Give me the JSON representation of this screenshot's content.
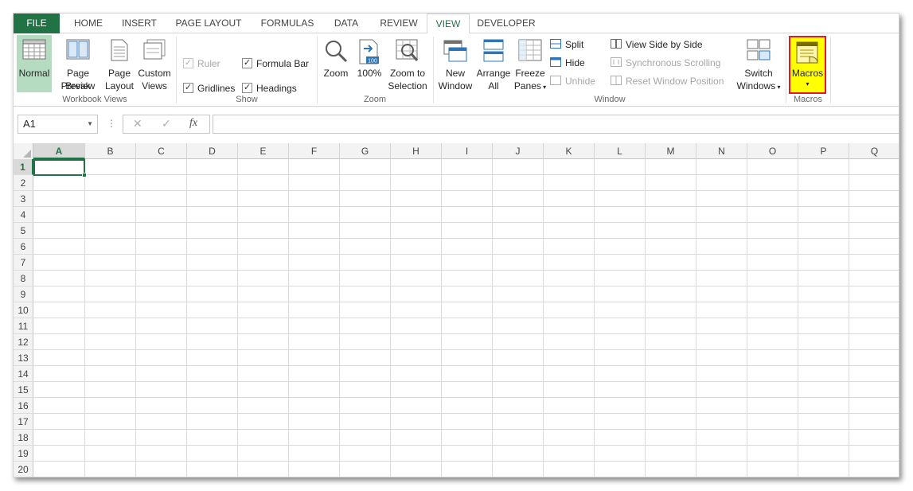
{
  "tabs": [
    "FILE",
    "HOME",
    "INSERT",
    "PAGE LAYOUT",
    "FORMULAS",
    "DATA",
    "REVIEW",
    "VIEW",
    "DEVELOPER"
  ],
  "active_tab": "VIEW",
  "colors": {
    "file_tab": "#217346",
    "accent": "#217346",
    "selected_button": "#b5dcc0",
    "highlight_fill": "#ffff00",
    "highlight_border": "#e8191d"
  },
  "ribbon": {
    "workbook_views": {
      "label": "Workbook Views",
      "normal": [
        "Normal"
      ],
      "page_break": [
        "Page Break",
        "Preview"
      ],
      "page_layout": [
        "Page",
        "Layout"
      ],
      "custom_views": [
        "Custom",
        "Views"
      ]
    },
    "show": {
      "label": "Show",
      "ruler": "Ruler",
      "formula_bar": "Formula Bar",
      "gridlines": "Gridlines",
      "headings": "Headings"
    },
    "zoom": {
      "label": "Zoom",
      "zoom": [
        "Zoom"
      ],
      "hundred": [
        "100%"
      ],
      "zoom_selection": [
        "Zoom to",
        "Selection"
      ],
      "icon_badge": "100"
    },
    "window": {
      "label": "Window",
      "new_window": [
        "New",
        "Window"
      ],
      "arrange_all": [
        "Arrange",
        "All"
      ],
      "freeze_panes": [
        "Freeze",
        "Panes"
      ],
      "split": "Split",
      "hide": "Hide",
      "unhide": "Unhide",
      "side_by_side": "View Side by Side",
      "sync_scroll": "Synchronous Scrolling",
      "reset_pos": "Reset Window Position",
      "switch_windows": [
        "Switch",
        "Windows"
      ]
    },
    "macros": {
      "label": "Macros",
      "macros": [
        "Macros"
      ]
    }
  },
  "formula_bar": {
    "name_box": "A1",
    "dots": "⋮",
    "cancel": "✕",
    "enter": "✓",
    "fx": "fx",
    "value": ""
  },
  "grid": {
    "columns": [
      "A",
      "B",
      "C",
      "D",
      "E",
      "F",
      "G",
      "H",
      "I",
      "J",
      "K",
      "L",
      "M",
      "N",
      "O",
      "P",
      "Q"
    ],
    "rows": [
      "1",
      "2",
      "3",
      "4",
      "5",
      "6",
      "7",
      "8",
      "9",
      "10",
      "11",
      "12",
      "13",
      "14",
      "15",
      "16",
      "17",
      "18",
      "19",
      "20"
    ],
    "active_cell": "A1"
  }
}
